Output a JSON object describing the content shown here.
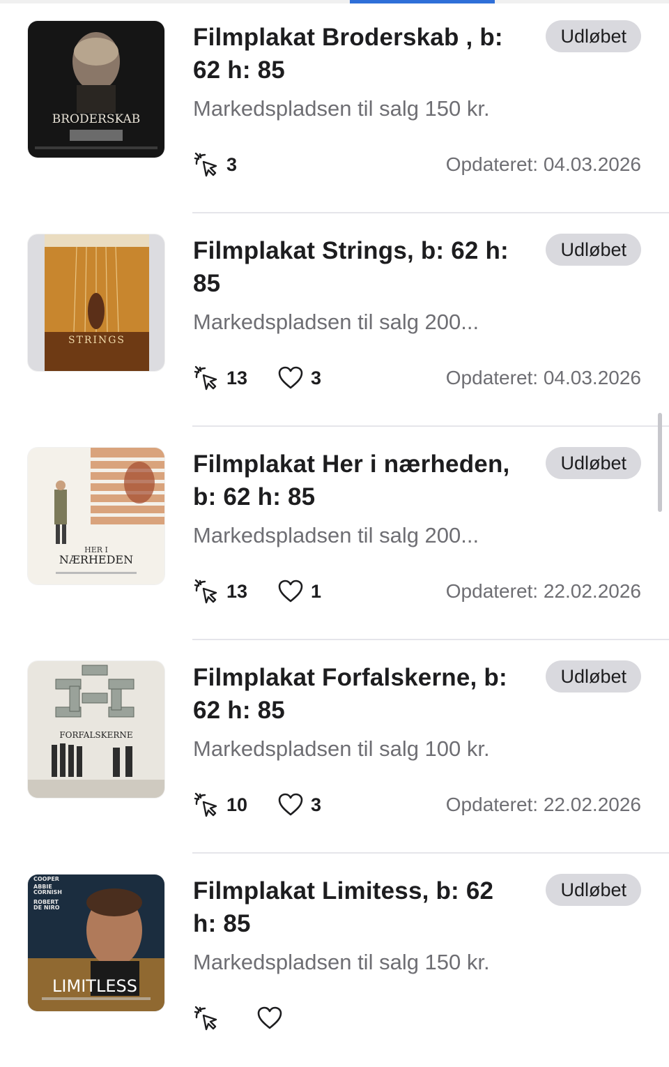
{
  "listings": [
    {
      "title": "Filmplakat Broderskab , b: 62 h: 85",
      "subtitle": "Markedspladsen til salg 150 kr.",
      "status": "Udløbet",
      "clicks": "3",
      "likes": "",
      "updated": "Opdateret: 04.03.2026",
      "poster_text": "BRODERSKAB"
    },
    {
      "title": "Filmplakat Strings, b: 62 h: 85",
      "subtitle": "Markedspladsen til salg 200...",
      "status": "Udløbet",
      "clicks": "13",
      "likes": "3",
      "updated": "Opdateret: 04.03.2026",
      "poster_text": "STRINGS"
    },
    {
      "title": "Filmplakat Her i nærheden, b: 62 h: 85",
      "subtitle": "Markedspladsen til salg 200...",
      "status": "Udløbet",
      "clicks": "13",
      "likes": "1",
      "updated": "Opdateret: 22.02.2026",
      "poster_text": "NÆRHEDEN",
      "poster_text_top": "HER I"
    },
    {
      "title": "Filmplakat Forfalskerne, b: 62 h: 85",
      "subtitle": "Markedspladsen til salg 100 kr.",
      "status": "Udløbet",
      "clicks": "10",
      "likes": "3",
      "updated": "Opdateret: 22.02.2026",
      "poster_text": "FORFALSKERNE"
    },
    {
      "title": "Filmplakat Limitess, b: 62 h: 85",
      "subtitle": "Markedspladsen til salg 150 kr.",
      "status": "Udløbet",
      "clicks": "",
      "likes": "",
      "updated": "",
      "poster_text": "LIMITLESS",
      "poster_cast": [
        "COOPER",
        "ABBIE",
        "CORNISH",
        "ROBERT",
        "DE NIRO"
      ]
    }
  ],
  "icons": {
    "clicks": "cursor-click-icon",
    "likes": "heart-icon"
  },
  "colors": {
    "accent": "#2f6fd8",
    "badge_bg": "#d9d9de",
    "muted_text": "#6e6e73"
  }
}
